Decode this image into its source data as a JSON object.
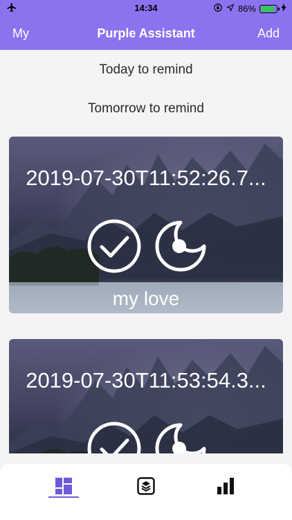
{
  "status_bar": {
    "time": "14:34",
    "battery": "86%",
    "icons": [
      "airplane-icon",
      "location-icon",
      "lock-rotation-icon",
      "battery-icon"
    ]
  },
  "nav": {
    "left": "My",
    "title": "Purple Assistant",
    "right": "Add"
  },
  "sections": {
    "today": "Today to remind",
    "tomorrow": "Tomorrow to remind"
  },
  "cards": [
    {
      "date": "2019-07-30T11:52:26.7...",
      "label": "my love"
    },
    {
      "date": "2019-07-30T11:53:54.3...",
      "label": ""
    }
  ],
  "tabbar": {
    "tabs": [
      "dashboard-icon",
      "layers-icon",
      "bar-chart-icon"
    ],
    "active": 0
  },
  "colors": {
    "nav": "#8b73f0",
    "accent": "#6d5ad9",
    "background": "#f4f3f5"
  }
}
